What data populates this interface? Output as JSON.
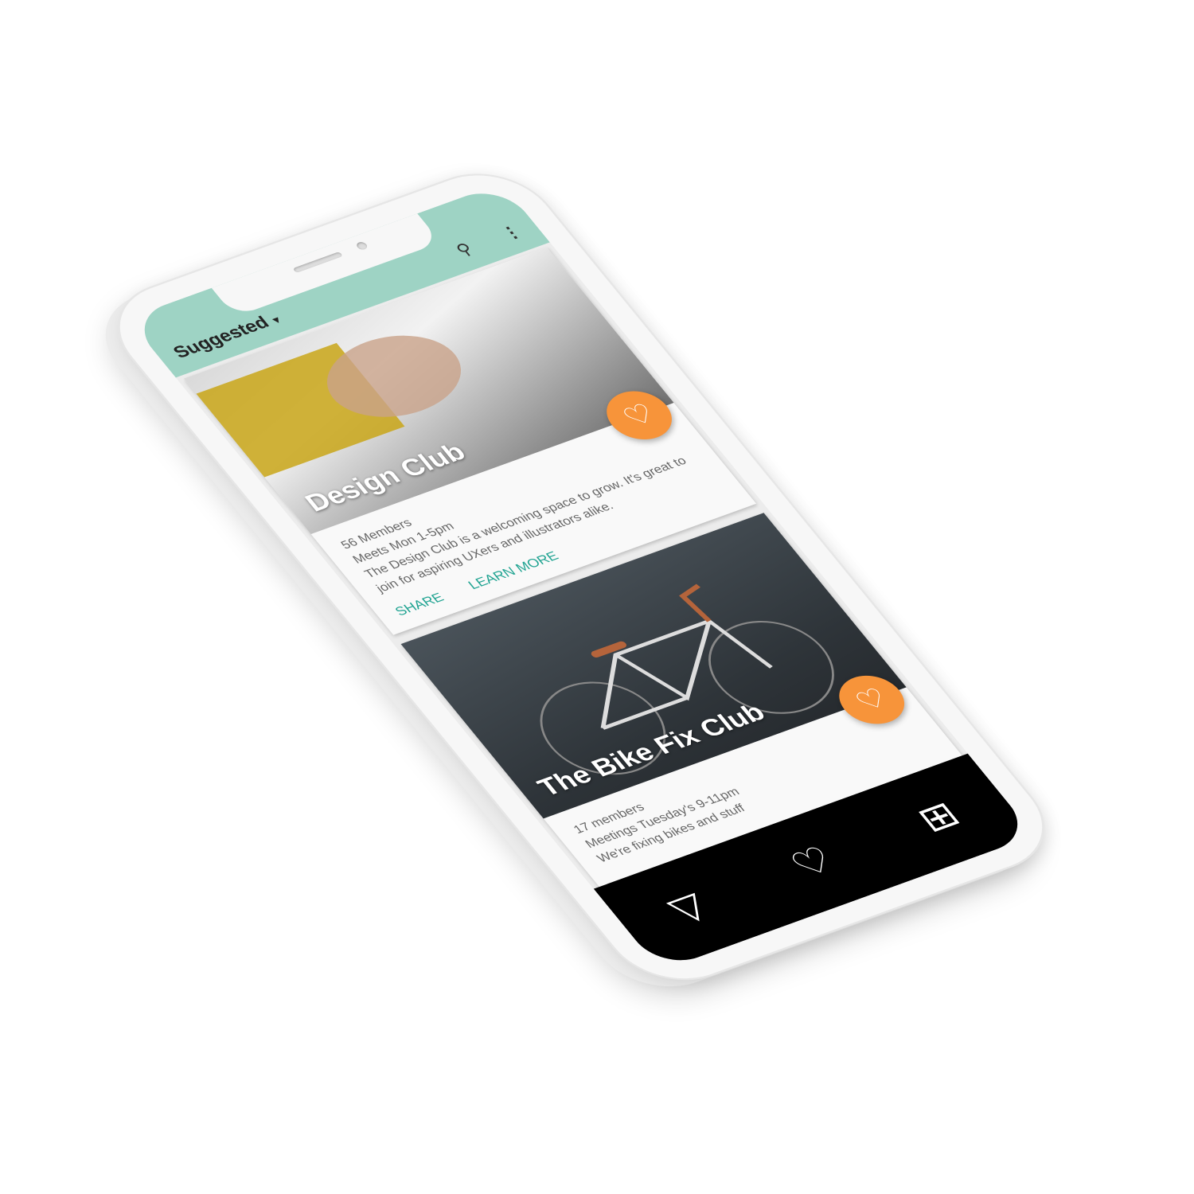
{
  "header": {
    "title": "Suggested",
    "caret": "▾",
    "search_icon": "⚲",
    "more_icon": "⋮"
  },
  "cards": [
    {
      "title": "Design Club",
      "members": "56 Members",
      "schedule": "Meets Mon 1-5pm",
      "description": "The Design Club is a welcoming space to grow. It's great to join for aspiring UXers and illustrators alike.",
      "share": "SHARE",
      "learn_more": "LEARN MORE"
    },
    {
      "title": "The Bike Fix Club",
      "members": "17 members",
      "schedule": "Meetings Tuesday's 9-11pm",
      "description": "We're fixing bikes and stuff"
    }
  ],
  "nav": {
    "back": "▽",
    "favorites": "♡",
    "add": "⊞"
  },
  "colors": {
    "header": "#9ed3c4",
    "accent": "#1fa391",
    "fab": "#f7943a"
  }
}
